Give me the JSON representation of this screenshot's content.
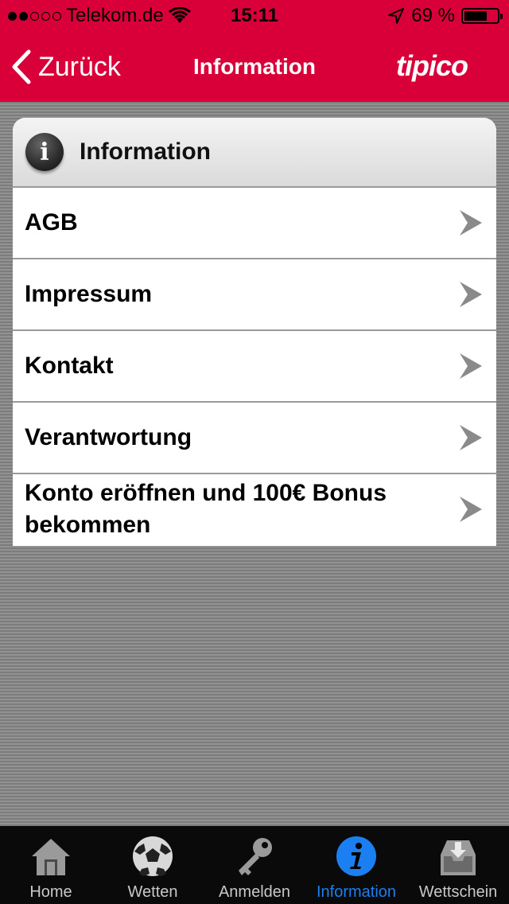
{
  "status_bar": {
    "carrier": "Telekom.de",
    "time": "15:11",
    "battery_text": "69 %",
    "battery_level": 0.69,
    "signal_dots_filled": 2,
    "signal_dots_total": 5
  },
  "nav": {
    "back_label": "Zurück",
    "title": "Information",
    "logo": "tipico"
  },
  "panel": {
    "title": "Information",
    "items": [
      {
        "label": "AGB"
      },
      {
        "label": "Impressum"
      },
      {
        "label": "Kontakt"
      },
      {
        "label": "Verantwortung"
      },
      {
        "label": "Konto eröffnen und 100€ Bonus bekommen"
      }
    ]
  },
  "tabbar": {
    "tabs": [
      {
        "label": "Home",
        "icon": "home-icon"
      },
      {
        "label": "Wetten",
        "icon": "soccer-ball-icon"
      },
      {
        "label": "Anmelden",
        "icon": "key-icon"
      },
      {
        "label": "Information",
        "icon": "info-icon",
        "active": true
      },
      {
        "label": "Wettschein",
        "icon": "inbox-icon"
      }
    ]
  },
  "colors": {
    "brand_red": "#d9003a",
    "active_blue": "#1b7ff2"
  }
}
